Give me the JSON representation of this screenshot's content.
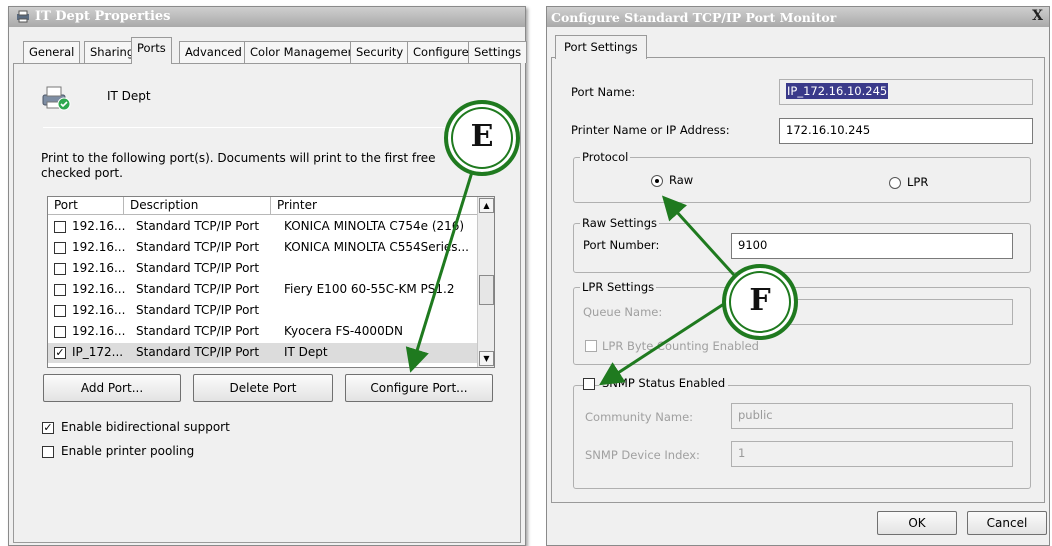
{
  "left": {
    "title": "IT Dept Properties",
    "tabs": [
      "General",
      "Sharing",
      "Ports",
      "Advanced",
      "Color Management",
      "Security",
      "Configure",
      "Settings"
    ],
    "printer_name": "IT Dept",
    "instructions": "Print to the following port(s). Documents will print to the first free checked port.",
    "columns": [
      "Port",
      "Description",
      "Printer"
    ],
    "rows": [
      {
        "port": "192.16...",
        "description": "Standard TCP/IP Port",
        "printer": "KONICA MINOLTA C754e (216)",
        "checked": false
      },
      {
        "port": "192.16...",
        "description": "Standard TCP/IP Port",
        "printer": "KONICA MINOLTA C554Series...",
        "checked": false
      },
      {
        "port": "192.16...",
        "description": "Standard TCP/IP Port",
        "printer": "",
        "checked": false
      },
      {
        "port": "192.16...",
        "description": "Standard TCP/IP Port",
        "printer": "Fiery E100 60-55C-KM PS1.2",
        "checked": false
      },
      {
        "port": "192.16...",
        "description": "Standard TCP/IP Port",
        "printer": "",
        "checked": false
      },
      {
        "port": "192.16...",
        "description": "Standard TCP/IP Port",
        "printer": "Kyocera FS-4000DN",
        "checked": false
      },
      {
        "port": "IP_172...",
        "description": "Standard TCP/IP Port",
        "printer": "IT Dept",
        "checked": true
      }
    ],
    "buttons": {
      "add_port": "Add Port...",
      "delete_port": "Delete Port",
      "configure_port": "Configure Port..."
    },
    "options": {
      "bidirectional": {
        "label": "Enable bidirectional support",
        "checked": true
      },
      "pooling": {
        "label": "Enable printer pooling",
        "checked": false
      }
    },
    "callout": "E"
  },
  "right": {
    "title": "Configure Standard TCP/IP Port Monitor",
    "tab": "Port Settings",
    "port_name_label": "Port Name:",
    "port_name_value": "IP_172.16.10.245",
    "address_label": "Printer Name or IP Address:",
    "address_value": "172.16.10.245",
    "protocol": {
      "title": "Protocol",
      "raw": "Raw",
      "lpr": "LPR",
      "selected": "Raw"
    },
    "raw_settings": {
      "title": "Raw Settings",
      "port_number_label": "Port Number:",
      "port_number_value": "9100"
    },
    "lpr_settings": {
      "title": "LPR Settings",
      "queue_name_label": "Queue Name:",
      "byte_counting_label": "LPR Byte Counting Enabled"
    },
    "snmp": {
      "title": "SNMP Status Enabled",
      "community_label": "Community Name:",
      "community_value": "public",
      "device_index_label": "SNMP Device Index:",
      "device_index_value": "1"
    },
    "buttons": {
      "ok": "OK",
      "cancel": "Cancel"
    },
    "callout": "F",
    "close_glyph": "X"
  },
  "annotation_color": "#1f7a1f"
}
